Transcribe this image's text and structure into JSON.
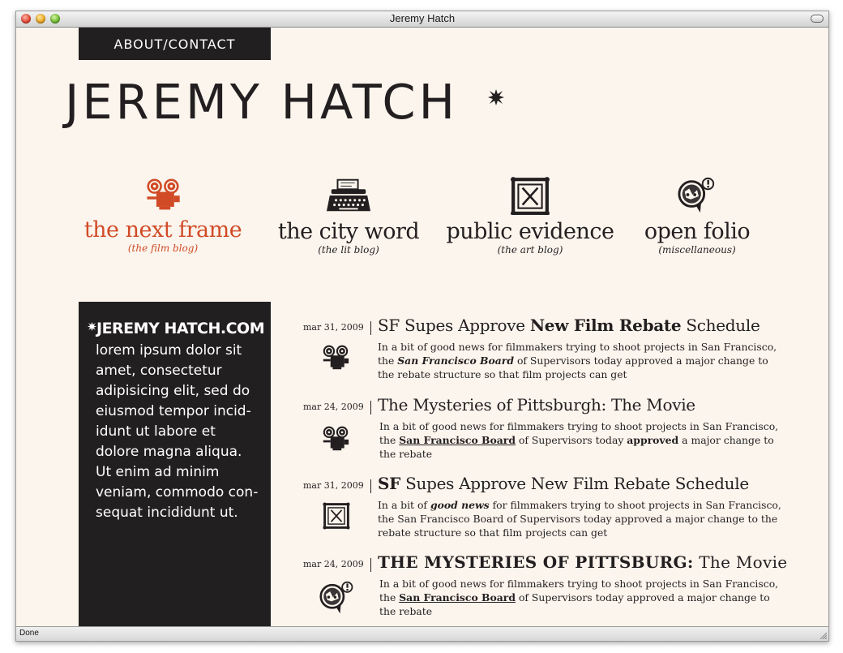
{
  "window": {
    "title": "Jeremy Hatch",
    "status": "Done"
  },
  "nav": {
    "about_contact": "ABOUT/CONTACT"
  },
  "site": {
    "title": "JEREMY HATCH"
  },
  "colors": {
    "accent": "#d14b27",
    "dark": "#231f20",
    "background": "#fbf5ed"
  },
  "blogs": [
    {
      "name": "the next frame",
      "sub": "(the film blog)",
      "icon": "film-projector-icon",
      "active": true
    },
    {
      "name": "the city word",
      "sub": "(the lit blog)",
      "icon": "typewriter-icon",
      "active": false
    },
    {
      "name": "public evidence",
      "sub": "(the art blog)",
      "icon": "picture-frame-icon",
      "active": false
    },
    {
      "name": "open folio",
      "sub": "(miscellaneous)",
      "icon": "speech-bubble-icon",
      "active": false
    }
  ],
  "sidebar": {
    "title": "JEREMY HATCH.COM",
    "lines": [
      "lorem ipsum dolor sit",
      "amet, consectetur",
      "adipisicing elit, sed do",
      "eiusmod tempor incid-",
      "idunt ut labore et",
      "dolore magna aliqua.",
      "Ut enim ad minim",
      "veniam, commodo con-",
      "sequat incididunt ut."
    ]
  },
  "posts": [
    {
      "date": "mar 31, 2009",
      "icon": "film-projector-icon",
      "title": {
        "pre": "SF Supes Approve ",
        "bold": "New Film Rebate",
        "post": " Schedule"
      },
      "body": {
        "line1": "In a bit of good news for filmmakers trying to shoot projects in San Francisco,",
        "line2_pre": "the ",
        "line2_emph": "San Francisco Board",
        "line2_post": " of Supervisors today approved a major change to",
        "line3": "the rebate structure so that film projects can get"
      }
    },
    {
      "date": "mar 24, 2009",
      "icon": "film-projector-icon",
      "title": {
        "text": "The Mysteries of Pittsburgh: The Movie"
      },
      "body": {
        "line1": "In a bit of good news for filmmakers trying to shoot projects in San Francisco,",
        "line2_pre": "the ",
        "line2_link": "San Francisco Board",
        "line2_mid": " of Supervisors today ",
        "line2_bold": "approved",
        "line2_post": " a major change to",
        "line3": "the rebate"
      }
    },
    {
      "date": "mar 31, 2009",
      "icon": "picture-frame-icon",
      "title": {
        "bold": "SF",
        "post": " Supes Approve New Film Rebate Schedule"
      },
      "body": {
        "line1_pre": "In a bit of ",
        "line1_emph": "good news",
        "line1_post": " for filmmakers trying to shoot projects in San Francisco,",
        "line2": "the San Francisco Board of Supervisors today approved a major change to the",
        "line3": "rebate structure so that film projects can get"
      }
    },
    {
      "date": "mar 24, 2009",
      "icon": "speech-bubble-icon",
      "title": {
        "bold": "THE MYSTERIES OF PITTSBURG:",
        "post": " The Movie"
      },
      "body": {
        "line1": "In a bit of good news for filmmakers trying to shoot projects in San Francisco,",
        "line2_pre": "the ",
        "line2_link": "San Francisco Board",
        "line2_post": " of Supervisors today approved a major change to",
        "line3": "the rebate"
      }
    }
  ]
}
